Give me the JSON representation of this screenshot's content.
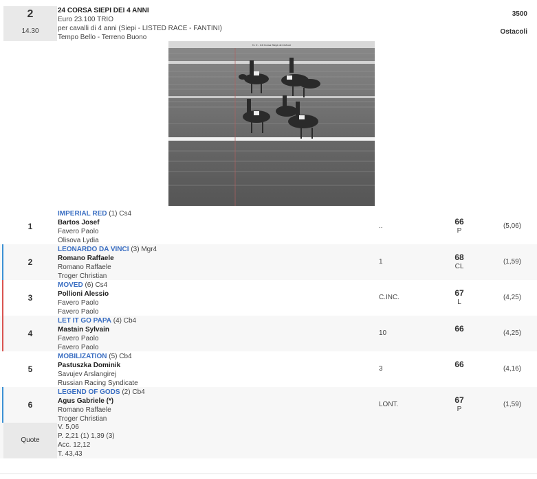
{
  "race": {
    "number": "2",
    "time": "14.30",
    "title": "24 CORSA SIEPI DEI 4 ANNI",
    "purse": "Euro 23.100 TRIO",
    "conditions": "per cavalli di 4 anni (Siepi -  LISTED RACE  - FANTINI)",
    "weather": "Tempo Bello - Terreno Buono",
    "distance": "3500",
    "type": "Ostacoli"
  },
  "photo": {
    "banner": "N. 2 - 24 Corsa Siepi dei 4 Anni"
  },
  "results": [
    {
      "pos": "1",
      "horse": "IMPERIAL RED",
      "info": "(1) Cs4",
      "jockey": "Bartos Josef",
      "trainer": "Favero Paolo",
      "owner": "Olisova Lydia",
      "distance": "..",
      "weight": "66",
      "weight_label": "P",
      "odds": "(5,06)",
      "bar_color": ""
    },
    {
      "pos": "2",
      "horse": "LEONARDO DA VINCI",
      "info": "(3) Mgr4",
      "jockey": "Romano Raffaele",
      "trainer": "Romano Raffaele",
      "owner": "Troger Christian",
      "distance": "1",
      "weight": "68",
      "weight_label": "CL",
      "odds": "(1,59)",
      "bar_color": "#3b8fd4"
    },
    {
      "pos": "3",
      "horse": "MOVED",
      "info": "(6) Cs4",
      "jockey": "Pollioni Alessio",
      "trainer": "Favero Paolo",
      "owner": "Favero Paolo",
      "distance": "C.INC.",
      "weight": "67",
      "weight_label": "L",
      "odds": "(4,25)",
      "bar_color": "#d9534f"
    },
    {
      "pos": "4",
      "horse": "LET IT GO PAPA",
      "info": "(4) Cb4",
      "jockey": "Mastain Sylvain",
      "trainer": "Favero Paolo",
      "owner": "Favero Paolo",
      "distance": "10",
      "weight": "66",
      "weight_label": "",
      "odds": "(4,25)",
      "bar_color": "#d9534f"
    },
    {
      "pos": "5",
      "horse": "MOBILIZATION",
      "info": "(5) Cb4",
      "jockey": "Pastuszka Dominik",
      "trainer": "Savujev Arslangirej",
      "owner": "Russian Racing Syndicate",
      "distance": "3",
      "weight": "66",
      "weight_label": "",
      "odds": "(4,16)",
      "bar_color": ""
    },
    {
      "pos": "6",
      "horse": "LEGEND OF GODS",
      "info": "(2) Cb4",
      "jockey": "Agus Gabriele (*)",
      "trainer": "Romano Raffaele",
      "owner": "Troger Christian",
      "distance": "LONT.",
      "weight": "67",
      "weight_label": "P",
      "odds": "(1,59)",
      "bar_color": "#3b8fd4"
    }
  ],
  "quote": {
    "label": "Quote",
    "lines": [
      "V. 5,06",
      "P. 2,21 (1)  1,39 (3)",
      "Acc. 12,12",
      "T. 43,43"
    ]
  }
}
